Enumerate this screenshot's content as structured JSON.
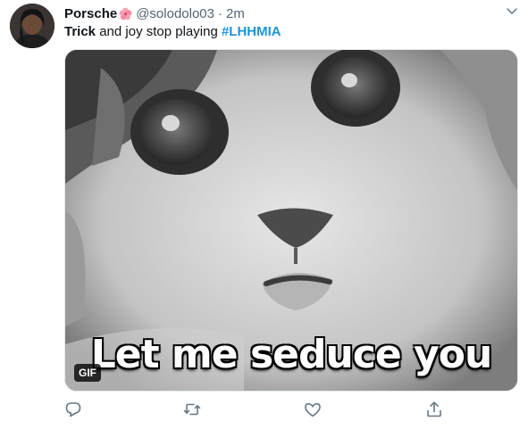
{
  "tweet": {
    "display_name": "Porsche",
    "name_emoji": "hibiscus-emoji",
    "handle": "@solodolo03",
    "separator": "·",
    "time": "2m",
    "text_bold": "Trick",
    "text_rest": " and joy stop playing ",
    "hashtag": "#LHHMIA",
    "media": {
      "caption": "Let me seduce you",
      "badge": "GIF"
    },
    "actions": [
      "reply-icon",
      "retweet-icon",
      "like-icon",
      "share-icon"
    ]
  },
  "colors": {
    "hashtag": "#1b95e0",
    "secondary_text": "#536471",
    "icon": "#657786"
  }
}
